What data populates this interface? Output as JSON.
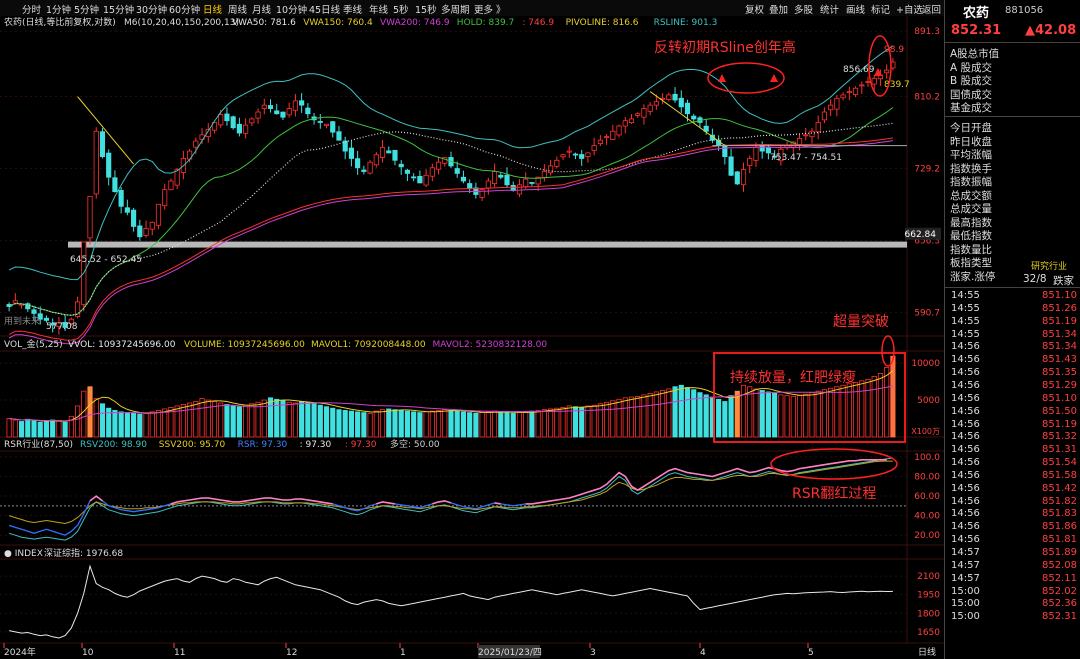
{
  "toolbar": {
    "timeframes": [
      "分时",
      "1分钟",
      "5分钟",
      "15分钟",
      "30分钟",
      "60分钟",
      "日线",
      "周线",
      "月线",
      "10分钟",
      "45日线",
      "季线",
      "年线",
      "5秒",
      "15秒",
      "多周期",
      "更多 》"
    ],
    "active_timeframe": "日线",
    "buttons": [
      "复权",
      "叠加",
      "多股",
      "统计",
      "画线",
      "标记",
      "+自选",
      "返回"
    ]
  },
  "price_panel": {
    "title": "农药(日线,等比前复权,对数)",
    "indicator_name": "M6(10,20,40,150,200,13)",
    "legend": [
      {
        "text": "VWA50: 781.6",
        "color": "#e8e8e8"
      },
      {
        "text": "VWA150: 760.4",
        "color": "#e8d020"
      },
      {
        "text": "VWA200: 746.9",
        "color": "#d040d0"
      },
      {
        "text": "HOLD: 839.7",
        "color": "#40c040"
      },
      {
        "text": ": 746.9",
        "color": "#ff4040"
      },
      {
        "text": "PIVOLINE: 816.6",
        "color": "#e8d020"
      },
      {
        "text": "RSLINE: 901.3",
        "color": "#40c0c0"
      }
    ],
    "y_ticks": [
      "891.3",
      "810.2",
      "729.2",
      "656.3",
      "590.7"
    ],
    "price_marker": "662.84",
    "annotations": {
      "low": "577.08",
      "gap": "645.52 - 652.45",
      "recent_range": "753.47 - 754.51",
      "high": "856.69",
      "hold": "839.7",
      "rs_high": "98.9",
      "usage_note": "用到未来"
    },
    "callout_rsline": "反转初期RSline创年高"
  },
  "volume_panel": {
    "title": "VOL_金(5,25)",
    "legend": [
      {
        "text": "VVOL: 10937245696.00",
        "color": "#e8e8e8"
      },
      {
        "text": "VOLUME: 10937245696.00",
        "color": "#e8d020"
      },
      {
        "text": "MAVOL1: 7092008448.00",
        "color": "#e8d020"
      },
      {
        "text": "MAVOL2: 5230832128.00",
        "color": "#d040d0"
      }
    ],
    "y_ticks": [
      "10000",
      "5000"
    ],
    "unit": "X100万",
    "callout_breakout": "超量突破",
    "callout_sustained": "持续放量，红肥绿瘦"
  },
  "rsr_panel": {
    "title": "RSR行业(87,50)",
    "legend": [
      {
        "text": "RSV200: 98.90",
        "color": "#40c0c0"
      },
      {
        "text": "SSV200: 95.70",
        "color": "#e8d020"
      },
      {
        "text": "RSR: 97.30",
        "color": "#4080ff"
      },
      {
        "text": ": 97.30",
        "color": "#e8e8e8"
      },
      {
        "text": ": 97.30",
        "color": "#ff4040"
      },
      {
        "text": "多空: 50.00",
        "color": "#cccccc"
      }
    ],
    "y_ticks": [
      "100.0",
      "80.00",
      "60.00",
      "40.00",
      "20.00"
    ],
    "callout": "RSR翻红过程"
  },
  "index_panel": {
    "title": "INDEX",
    "legend_text": "深证综指: 1976.68",
    "y_ticks": [
      "2100",
      "1950",
      "1800",
      "1650"
    ]
  },
  "x_axis": {
    "labels": [
      "2024年",
      "10",
      "11",
      "12",
      "1",
      "2025/01/23/四",
      "3",
      "4",
      "5"
    ],
    "period": "日线"
  },
  "sidebar": {
    "name": "农药",
    "code": "881056",
    "price": "852.31",
    "change": "▲42.08",
    "market_labels": [
      "A股总市值",
      "A 股成交",
      "B 股成交",
      "国债成交",
      "基金成交"
    ],
    "stat_labels": [
      "今日开盘",
      "昨日收盘",
      "平均涨幅",
      "指数换手",
      "指数振幅",
      "总成交额",
      "总成交量",
      "最高指数",
      "最低指数",
      "指数量比",
      "板指类型",
      "涨家.涨停"
    ],
    "board_type_value": "研究行业",
    "up_limit_value": "32/8",
    "fall_label": "跌家",
    "ticks": [
      {
        "t": "14:55",
        "p": "851.10"
      },
      {
        "t": "14:55",
        "p": "851.26"
      },
      {
        "t": "14:55",
        "p": "851.19"
      },
      {
        "t": "14:55",
        "p": "851.34"
      },
      {
        "t": "14:56",
        "p": "851.34"
      },
      {
        "t": "14:56",
        "p": "851.43"
      },
      {
        "t": "14:56",
        "p": "851.35"
      },
      {
        "t": "14:56",
        "p": "851.29"
      },
      {
        "t": "14:56",
        "p": "851.10"
      },
      {
        "t": "14:56",
        "p": "851.50"
      },
      {
        "t": "14:56",
        "p": "851.19"
      },
      {
        "t": "14:56",
        "p": "851.32"
      },
      {
        "t": "14:56",
        "p": "851.31"
      },
      {
        "t": "14:56",
        "p": "851.54"
      },
      {
        "t": "14:56",
        "p": "851.58"
      },
      {
        "t": "14:56",
        "p": "851.42"
      },
      {
        "t": "14:56",
        "p": "851.82"
      },
      {
        "t": "14:56",
        "p": "851.83"
      },
      {
        "t": "14:56",
        "p": "851.86"
      },
      {
        "t": "14:56",
        "p": "851.81"
      },
      {
        "t": "14:57",
        "p": "851.89"
      },
      {
        "t": "14:57",
        "p": "852.08"
      },
      {
        "t": "14:57",
        "p": "852.11"
      },
      {
        "t": "15:00",
        "p": "852.02"
      },
      {
        "t": "15:00",
        "p": "852.36"
      },
      {
        "t": "15:00",
        "p": "852.31"
      }
    ]
  },
  "chart_data": {
    "type": "candlestick",
    "scale": "log",
    "ylim": [
      570,
      910
    ],
    "description_series": [
      "price_close",
      "volume",
      "rsr",
      "rsv200",
      "ssv200",
      "index"
    ],
    "price_close": [
      596,
      601,
      598,
      594,
      590,
      585,
      584,
      580,
      582,
      578,
      585,
      600,
      655,
      700,
      770,
      742,
      720,
      705,
      690,
      684,
      670,
      660,
      668,
      674,
      692,
      707,
      716,
      728,
      740,
      748,
      759,
      766,
      772,
      780,
      789,
      782,
      774,
      768,
      777,
      784,
      792,
      800,
      796,
      790,
      786,
      796,
      805,
      800,
      790,
      783,
      780,
      778,
      769,
      760,
      748,
      740,
      730,
      726,
      736,
      744,
      752,
      746,
      738,
      731,
      724,
      720,
      714,
      722,
      730,
      736,
      741,
      732,
      724,
      716,
      708,
      702,
      707,
      716,
      726,
      720,
      712,
      706,
      712,
      718,
      714,
      720,
      726,
      732,
      738,
      744,
      748,
      744,
      740,
      746,
      754,
      760,
      764,
      770,
      776,
      782,
      784,
      790,
      796,
      800,
      804,
      808,
      812,
      806,
      798,
      790,
      784,
      780,
      770,
      760,
      754,
      742,
      722,
      713,
      728,
      740,
      752,
      748,
      746,
      742,
      750,
      754,
      758,
      762,
      766,
      770,
      780,
      792,
      800,
      808,
      812,
      816,
      820,
      824,
      828,
      832,
      836,
      842,
      852
    ],
    "volume": [
      2500,
      2300,
      2100,
      2400,
      2200,
      2000,
      2100,
      2300,
      2200,
      2000,
      2800,
      4200,
      6200,
      6800,
      5200,
      4500,
      3900,
      3600,
      3400,
      3300,
      3200,
      3100,
      3200,
      3400,
      3600,
      3800,
      4000,
      4200,
      4400,
      4600,
      4800,
      5200,
      5000,
      4800,
      4600,
      4400,
      4200,
      4100,
      4300,
      4500,
      4700,
      5000,
      5300,
      5100,
      4900,
      4700,
      4600,
      4800,
      4700,
      4500,
      4300,
      4100,
      3900,
      3700,
      3600,
      3500,
      3400,
      3300,
      3200,
      3500,
      3700,
      3800,
      3700,
      3600,
      3500,
      3400,
      3300,
      3400,
      3500,
      3600,
      3700,
      3600,
      3500,
      3400,
      3300,
      3200,
      3300,
      3400,
      3500,
      3400,
      3300,
      3200,
      3300,
      3400,
      3500,
      3600,
      3700,
      3800,
      3900,
      4000,
      4200,
      4100,
      4000,
      4200,
      4300,
      4500,
      4700,
      4900,
      5100,
      5300,
      5400,
      5500,
      5700,
      5900,
      6100,
      6300,
      6500,
      6800,
      7000,
      6700,
      6400,
      6000,
      5700,
      5400,
      5100,
      4800,
      5600,
      6200,
      7000,
      6800,
      6500,
      6300,
      6100,
      5900,
      5700,
      5600,
      5500,
      5600,
      5800,
      6000,
      6200,
      6400,
      6600,
      6800,
      7000,
      7200,
      7400,
      7600,
      7800,
      8200,
      8600,
      9400,
      10937
    ],
    "rsr": [
      30,
      28,
      26,
      24,
      22,
      24,
      26,
      24,
      22,
      20,
      24,
      30,
      42,
      55,
      60,
      55,
      50,
      48,
      46,
      45,
      44,
      45,
      46,
      47,
      48,
      50,
      52,
      54,
      55,
      56,
      57,
      58,
      58,
      57,
      56,
      55,
      54,
      54,
      55,
      56,
      57,
      58,
      58,
      57,
      56,
      56,
      57,
      57,
      56,
      55,
      54,
      53,
      52,
      50,
      48,
      46,
      45,
      47,
      50,
      52,
      54,
      53,
      52,
      51,
      50,
      49,
      48,
      50,
      52,
      54,
      55,
      53,
      51,
      49,
      48,
      47,
      49,
      51,
      53,
      52,
      51,
      50,
      51,
      52,
      52,
      53,
      54,
      55,
      56,
      57,
      58,
      60,
      62,
      64,
      66,
      68,
      72,
      78,
      84,
      80,
      70,
      66,
      70,
      74,
      78,
      82,
      86,
      88,
      86,
      84,
      83,
      82,
      81,
      80,
      82,
      84,
      86,
      88,
      86,
      84,
      85,
      87,
      89,
      88,
      86,
      85,
      86,
      88,
      89,
      90,
      91,
      92,
      93,
      94,
      95,
      96,
      96,
      97,
      97,
      97,
      97,
      97
    ],
    "rsv200": [
      22,
      20,
      18,
      17,
      16,
      17,
      18,
      17,
      16,
      15,
      18,
      24,
      36,
      48,
      54,
      50,
      46,
      44,
      42,
      41,
      40,
      41,
      42,
      43,
      44,
      46,
      48,
      50,
      51,
      52,
      53,
      54,
      54,
      53,
      52,
      51,
      50,
      50,
      51,
      52,
      53,
      54,
      54,
      53,
      52,
      52,
      53,
      53,
      52,
      51,
      50,
      49,
      48,
      46,
      44,
      42,
      41,
      43,
      46,
      48,
      50,
      49,
      48,
      47,
      46,
      45,
      44,
      46,
      48,
      50,
      51,
      49,
      47,
      45,
      44,
      43,
      45,
      47,
      49,
      48,
      47,
      46,
      47,
      48,
      48,
      49,
      50,
      51,
      52,
      53,
      54,
      56,
      58,
      60,
      62,
      64,
      68,
      74,
      80,
      76,
      66,
      62,
      66,
      70,
      74,
      78,
      82,
      84,
      82,
      80,
      79,
      78,
      77,
      76,
      78,
      80,
      82,
      84,
      82,
      80,
      81,
      83,
      85,
      84,
      82,
      81,
      82,
      84,
      85,
      86,
      87,
      88,
      89,
      90,
      91,
      92,
      93,
      94,
      95,
      96,
      97,
      98,
      98.9
    ],
    "ssv200": [
      40,
      38,
      36,
      34,
      33,
      34,
      35,
      34,
      33,
      32,
      34,
      38,
      44,
      50,
      54,
      52,
      50,
      49,
      48,
      47,
      47,
      47,
      48,
      48,
      49,
      50,
      51,
      52,
      53,
      53,
      54,
      54,
      54,
      54,
      53,
      53,
      52,
      52,
      53,
      53,
      54,
      54,
      54,
      54,
      53,
      53,
      53,
      53,
      53,
      52,
      52,
      51,
      50,
      49,
      48,
      47,
      46,
      47,
      48,
      49,
      50,
      50,
      49,
      49,
      48,
      48,
      47,
      48,
      49,
      50,
      50,
      49,
      48,
      47,
      47,
      46,
      47,
      48,
      49,
      49,
      48,
      48,
      48,
      49,
      49,
      50,
      50,
      51,
      52,
      53,
      54,
      55,
      56,
      58,
      60,
      62,
      65,
      70,
      74,
      72,
      68,
      66,
      67,
      69,
      71,
      74,
      77,
      79,
      79,
      78,
      77,
      77,
      76,
      76,
      77,
      78,
      80,
      81,
      81,
      80,
      80,
      81,
      83,
      83,
      82,
      82,
      82,
      83,
      84,
      85,
      86,
      87,
      88,
      89,
      90,
      91,
      92,
      93,
      94,
      95,
      95.5,
      95.7,
      95.7
    ],
    "index": [
      1660,
      1650,
      1640,
      1645,
      1630,
      1620,
      1625,
      1610,
      1600,
      1620,
      1680,
      1800,
      1960,
      2180,
      2040,
      2010,
      1990,
      1960,
      1940,
      1930,
      1950,
      1980,
      2000,
      2020,
      2040,
      2060,
      2070,
      2080,
      2060,
      2050,
      2080,
      2100,
      2090,
      2080,
      2060,
      2050,
      2080,
      2070,
      2050,
      2040,
      2030,
      2060,
      2080,
      2090,
      2070,
      2050,
      2030,
      2020,
      2010,
      2000,
      1990,
      1970,
      1950,
      1930,
      1900,
      1880,
      1870,
      1890,
      1900,
      1910,
      1900,
      1880,
      1870,
      1860,
      1870,
      1880,
      1890,
      1900,
      1910,
      1920,
      1930,
      1940,
      1950,
      1960,
      1940,
      1930,
      1920,
      1910,
      1930,
      1940,
      1950,
      1960,
      1970,
      1980,
      1990,
      1980,
      1970,
      1960,
      1950,
      1960,
      1970,
      1980,
      1990,
      1980,
      1970,
      1960,
      1950,
      1940,
      1950,
      1960,
      1970,
      1980,
      1990,
      2000,
      1990,
      1980,
      1970,
      1960,
      1950,
      1940,
      1880,
      1830,
      1840,
      1850,
      1860,
      1870,
      1880,
      1890,
      1900,
      1910,
      1920,
      1930,
      1940,
      1950,
      1955,
      1960,
      1958,
      1962,
      1965,
      1968,
      1970,
      1972,
      1975,
      1970,
      1968,
      1972,
      1975,
      1978,
      1974,
      1976,
      1977,
      1976,
      1976.68
    ]
  }
}
